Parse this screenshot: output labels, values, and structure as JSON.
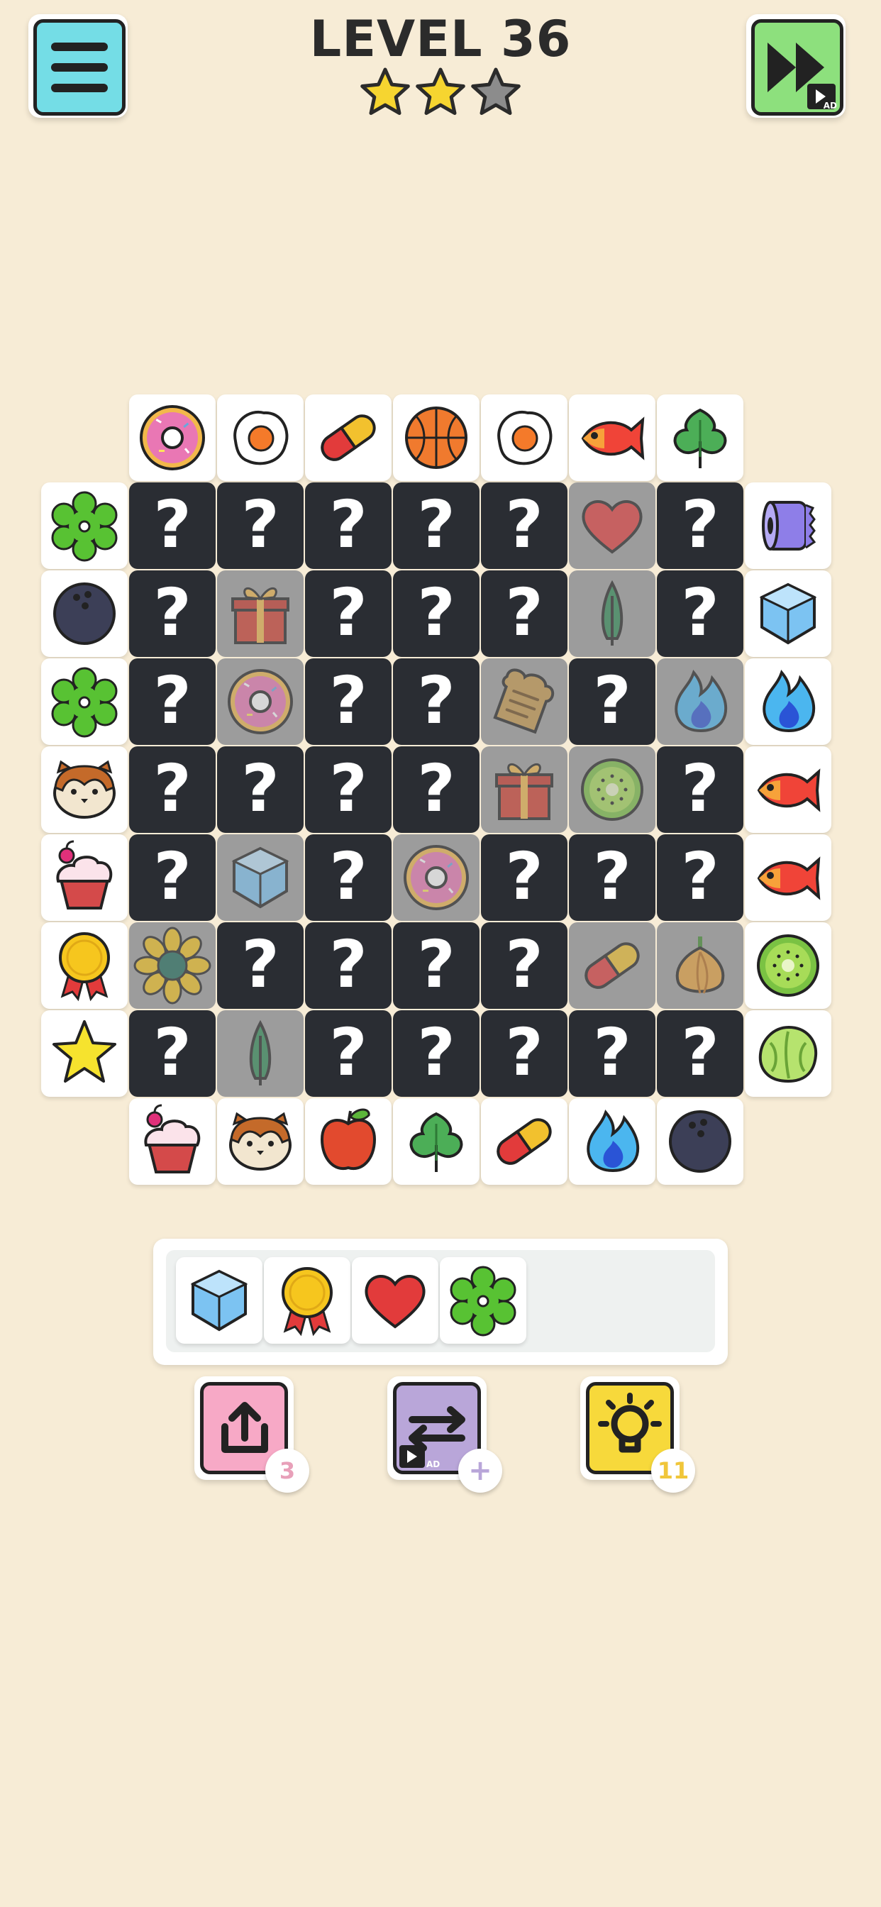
{
  "header": {
    "title": "LEVEL 36",
    "stars_earned": 2,
    "stars_total": 3,
    "menu_icon": "hamburger-icon",
    "skip_icon": "fast-forward-icon",
    "skip_badge": "AD"
  },
  "colors": {
    "background": "#f7ecd6",
    "hidden_tile": "#2a2d33",
    "menu_button": "#74dde6",
    "skip_button": "#8de07d",
    "undo_button": "#f7a9c6",
    "shuffle_button": "#b9a6d9",
    "hint_button": "#f7d93b"
  },
  "board": {
    "hidden_symbol": "?",
    "rows": [
      [
        "",
        "donut",
        "egg",
        "pill",
        "basketball",
        "egg",
        "fish",
        "leaf",
        ""
      ],
      [
        "clover",
        "?",
        "?",
        "?",
        "?",
        "?",
        "heart",
        "?",
        "paper-towel"
      ],
      [
        "bowling-ball",
        "?",
        "gift",
        "?",
        "?",
        "?",
        "tree",
        "?",
        "ice-cube"
      ],
      [
        "clover",
        "?",
        "donut",
        "?",
        "?",
        "toast",
        "?",
        "flame",
        "flame"
      ],
      [
        "hamster",
        "?",
        "?",
        "?",
        "?",
        "gift",
        "kiwi",
        "?",
        "fish"
      ],
      [
        "cupcake",
        "?",
        "ice-cube",
        "?",
        "donut",
        "?",
        "?",
        "?",
        "fish"
      ],
      [
        "medal",
        "sunflower",
        "?",
        "?",
        "?",
        "?",
        "pill",
        "onion",
        "kiwi"
      ],
      [
        "star",
        "?",
        "tree",
        "?",
        "?",
        "?",
        "?",
        "?",
        "lettuce"
      ],
      [
        "",
        "cupcake",
        "hamster",
        "apple",
        "leaf",
        "pill",
        "flame",
        "bowling-ball",
        ""
      ]
    ],
    "dimmed": [
      [
        1,
        6
      ],
      [
        2,
        2
      ],
      [
        2,
        6
      ],
      [
        3,
        2
      ],
      [
        3,
        5
      ],
      [
        3,
        7
      ],
      [
        4,
        5
      ],
      [
        4,
        6
      ],
      [
        5,
        2
      ],
      [
        5,
        4
      ],
      [
        6,
        1
      ],
      [
        6,
        6
      ],
      [
        6,
        7
      ],
      [
        7,
        2
      ]
    ]
  },
  "tray": {
    "capacity": 7,
    "items": [
      "ice-cube",
      "medal",
      "heart",
      "clover"
    ]
  },
  "tools": [
    {
      "name": "undo",
      "icon": "share-up-icon",
      "count": "3",
      "count_color": "#e8a0b9"
    },
    {
      "name": "shuffle",
      "icon": "shuffle-arrows-icon",
      "count": "+",
      "count_color": "#b9a6d9",
      "ad": "AD"
    },
    {
      "name": "hint",
      "icon": "lightbulb-icon",
      "count": "11",
      "count_color": "#f0c63a"
    }
  ]
}
